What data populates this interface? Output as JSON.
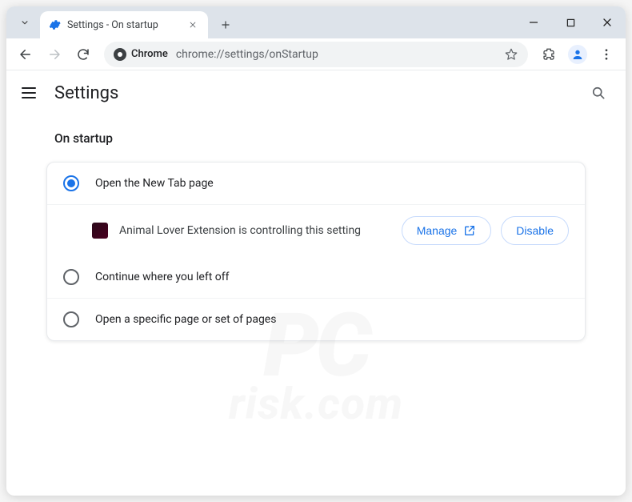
{
  "tab": {
    "title": "Settings - On startup"
  },
  "omnibox": {
    "chip": "Chrome",
    "url": "chrome://settings/onStartup"
  },
  "settings": {
    "title": "Settings",
    "section_title": "On startup",
    "options": [
      {
        "label": "Open the New Tab page",
        "selected": true
      },
      {
        "label": "Continue where you left off",
        "selected": false
      },
      {
        "label": "Open a specific page or set of pages",
        "selected": false
      }
    ],
    "extension_notice": {
      "text": "Animal Lover Extension is controlling this setting",
      "manage": "Manage",
      "disable": "Disable"
    }
  },
  "watermark": {
    "line1": "PC",
    "line2": "risk.com"
  }
}
